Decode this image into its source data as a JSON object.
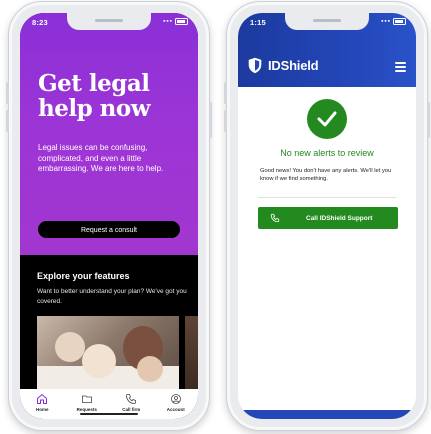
{
  "left_app": {
    "status_time": "8:23",
    "hero_title": "Get legal help now",
    "hero_body": "Legal issues can be confusing, complicated, and even a little embarrassing. We are here to help.",
    "consult_button": "Request a consult",
    "explore_title": "Explore your features",
    "explore_desc": "Want to better understand your plan? We've got you covered.",
    "tabs": [
      {
        "label": "Home",
        "icon": "home-icon"
      },
      {
        "label": "Requests",
        "icon": "folder-icon"
      },
      {
        "label": "Call firm",
        "icon": "phone-icon"
      },
      {
        "label": "Account",
        "icon": "user-icon"
      }
    ],
    "colors": {
      "hero": "#9c35d6",
      "background": "#000000"
    }
  },
  "right_app": {
    "status_time": "1:15",
    "brand": "IDShield",
    "alerts_title": "No new alerts to review",
    "alerts_desc": "Good news!  You don't have any alerts.  We'll let you know if we find something.",
    "support_button": "Call IDShield Support",
    "colors": {
      "header": "#2346b8",
      "success": "#238a20"
    }
  }
}
